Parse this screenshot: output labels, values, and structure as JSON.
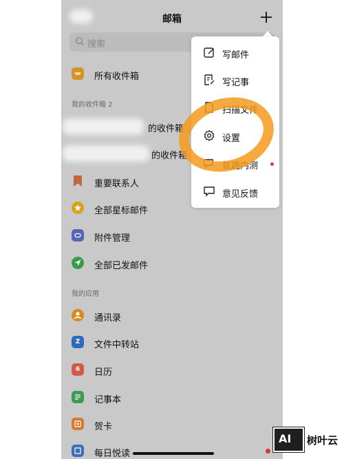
{
  "header": {
    "title": "邮箱"
  },
  "search": {
    "placeholder": "搜索"
  },
  "inboxes": {
    "all_inboxes": "所有收件箱",
    "section_label": "我的收件箱 2",
    "account1_suffix": "的收件箱",
    "account2_suffix": "的收件箱"
  },
  "folders": [
    {
      "label": "重要联系人",
      "icon": "bookmark-icon",
      "color": "#c0683c"
    },
    {
      "label": "全部星标邮件",
      "icon": "star-icon",
      "color": "#d8a21e"
    },
    {
      "label": "附件管理",
      "icon": "attachment-icon",
      "color": "#5464b8"
    },
    {
      "label": "全部已发邮件",
      "icon": "send-icon",
      "color": "#3a9a4c"
    }
  ],
  "apps": {
    "section_label": "我的应用",
    "items": [
      {
        "label": "通讯录",
        "icon": "contacts-icon",
        "color": "#d98a1f"
      },
      {
        "label": "文件中转站",
        "icon": "file-transfer-icon",
        "color": "#2a6bbd",
        "glyph": "Z"
      },
      {
        "label": "日历",
        "icon": "calendar-icon",
        "color": "#d25a4a",
        "glyph": "6"
      },
      {
        "label": "记事本",
        "icon": "notebook-icon",
        "color": "#3c9a55"
      },
      {
        "label": "贺卡",
        "icon": "greeting-card-icon",
        "color": "#d77a2e"
      },
      {
        "label": "每日悦读",
        "icon": "daily-reading-icon",
        "color": "#3d6fb5"
      }
    ]
  },
  "menu": {
    "items": [
      {
        "label": "写邮件",
        "icon": "compose-icon"
      },
      {
        "label": "写记事",
        "icon": "note-icon"
      },
      {
        "label": "扫描文件",
        "icon": "scan-icon"
      },
      {
        "label": "设置",
        "icon": "gear-icon"
      },
      {
        "label": "就趣内测",
        "icon": "beta-icon"
      },
      {
        "label": "意见反馈",
        "icon": "feedback-icon"
      }
    ]
  },
  "watermark": {
    "logo": "AI",
    "text": "树叶云"
  },
  "colors": {
    "highlight": "#f59a1c",
    "badge": "#d23b3b"
  }
}
